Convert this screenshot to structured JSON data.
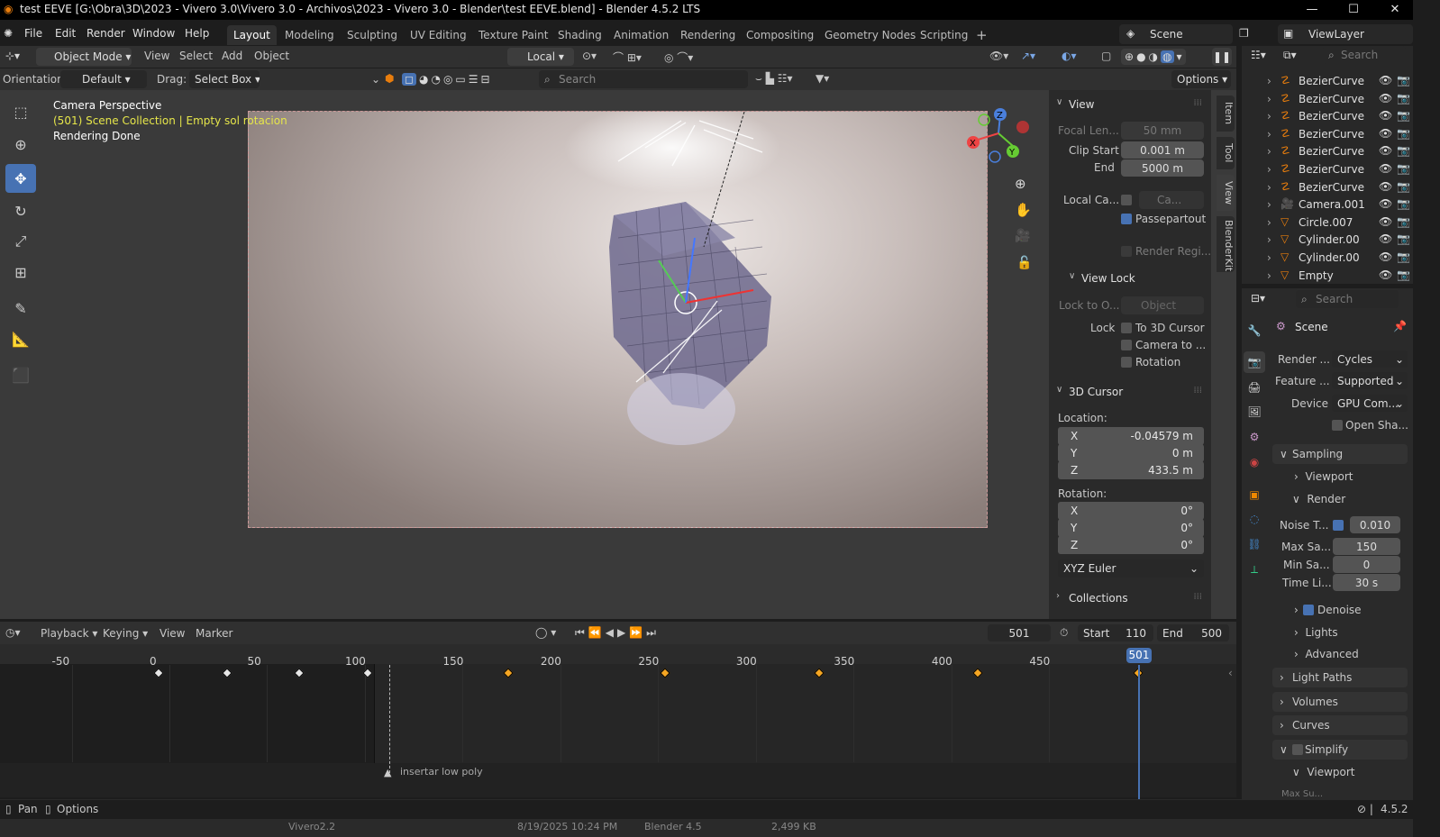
{
  "titlebar": {
    "title": "test EEVE [G:\\Obra\\3D\\2023 - Vivero 3.0\\Vivero 3.0 - Archivos\\2023 - Vivero 3.0 - Blender\\test EEVE.blend] - Blender 4.5.2 LTS",
    "minimize": "—",
    "maximize": "☐",
    "close": "✕"
  },
  "menu": [
    "File",
    "Edit",
    "Render",
    "Window",
    "Help"
  ],
  "workspaces": [
    "Layout",
    "Modeling",
    "Sculpting",
    "UV Editing",
    "Texture Paint",
    "Shading",
    "Animation",
    "Rendering",
    "Compositing",
    "Geometry Nodes",
    "Scripting",
    "+"
  ],
  "scene_selector": "Scene",
  "view_layer": "ViewLayer",
  "vp_header": {
    "mode": "Object Mode",
    "menus": [
      "View",
      "Select",
      "Add",
      "Object"
    ],
    "transform": "Local",
    "options": "Options"
  },
  "vp_header2": {
    "orientation_label": "Orientation:",
    "orientation": "Default",
    "drag_label": "Drag:",
    "drag": "Select Box",
    "search": "Search"
  },
  "viewport_info": {
    "line1": "Camera Perspective",
    "line2": "(501) Scene Collection | Empty sol rotacion",
    "line3": "Rendering Done"
  },
  "gizmo": {
    "z": "Z",
    "y": "Y",
    "x": "X"
  },
  "npanel": {
    "view_title": "View",
    "focal_label": "Focal Len...",
    "focal": "50 mm",
    "clip_start_label": "Clip Start",
    "clip_start": "0.001 m",
    "clip_end_label": "End",
    "clip_end": "5000 m",
    "local_cam_label": "Local Ca...",
    "local_cam_field": "Ca...",
    "passepartout": "Passepartout",
    "render_region": "Render Regi...",
    "view_lock_title": "View Lock",
    "lock_to_label": "Lock to O...",
    "lock_to_field": "Object",
    "lock_label": "Lock",
    "lock_cursor": "To 3D Cursor",
    "lock_camera": "Camera to ...",
    "lock_rotation": "Rotation",
    "cursor_title": "3D Cursor",
    "location_label": "Location:",
    "loc_x": "-0.04579 m",
    "loc_y": "0 m",
    "loc_z": "433.5 m",
    "rotation_label": "Rotation:",
    "rot_x": "0°",
    "rot_y": "0°",
    "rot_z": "0°",
    "rot_mode": "XYZ Euler",
    "x": "X",
    "y": "Y",
    "z": "Z",
    "collections_title": "Collections"
  },
  "vtabs": [
    "Item",
    "Tool",
    "View",
    "BlenderKit"
  ],
  "outliner": {
    "search": "Search",
    "items": [
      "BezierCurve",
      "BezierCurve",
      "BezierCurve",
      "BezierCurve",
      "BezierCurve",
      "BezierCurve",
      "BezierCurve",
      "Camera.001",
      "Circle.007",
      "Cylinder.00",
      "Cylinder.00",
      "Empty"
    ]
  },
  "props": {
    "search": "Search",
    "scene": "Scene",
    "render_label": "Render ...",
    "render_engine": "Cycles",
    "feature_label": "Feature ...",
    "feature": "Supported",
    "device_label": "Device",
    "device": "GPU Com...",
    "open_shading": "Open Sha...",
    "sampling": "Sampling",
    "viewport": "Viewport",
    "render": "Render",
    "noise_label": "Noise T...",
    "noise": "0.010",
    "max_label": "Max Sa...",
    "max": "150",
    "min_label": "Min Sa...",
    "min": "0",
    "time_label": "Time Li...",
    "time": "30 s",
    "denoise": "Denoise",
    "lights": "Lights",
    "advanced": "Advanced",
    "light_paths": "Light Paths",
    "volumes": "Volumes",
    "curves": "Curves",
    "simplify": "Simplify",
    "simplify_viewport": "Viewport",
    "max_su": "Max Su..."
  },
  "timeline": {
    "menus": [
      "Playback",
      "Keying",
      "View",
      "Marker"
    ],
    "current": "501",
    "start_label": "Start",
    "start": "110",
    "end_label": "End",
    "end": "500",
    "ticks": [
      "-50",
      "0",
      "50",
      "100",
      "150",
      "200",
      "250",
      "300",
      "350",
      "400",
      "450"
    ],
    "marker": "insertar low poly",
    "playhead": "501",
    "keys_white": [
      0,
      35,
      72,
      107
    ],
    "keys_orange": [
      179,
      259,
      338,
      419
    ]
  },
  "status": {
    "pan": "Pan",
    "options": "Options",
    "version": "4.5.2",
    "taskbar": [
      "Vivero2.2",
      "8/19/2025 10:24 PM",
      "Blender 4.5",
      "2,499 KB"
    ]
  },
  "colors": {
    "accent": "#4772b3",
    "key_orange": "#f5a623",
    "text_yellow": "#e6e64a"
  }
}
